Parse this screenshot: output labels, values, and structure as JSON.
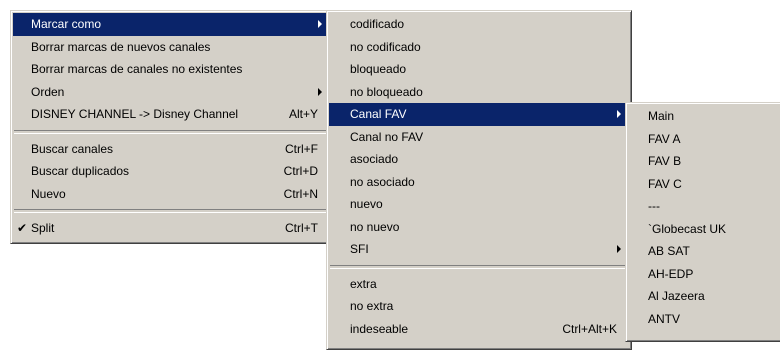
{
  "menu1": {
    "items": [
      {
        "label": "Marcar como"
      },
      {
        "label": "Borrar marcas de nuevos canales"
      },
      {
        "label": "Borrar marcas de canales no existentes"
      },
      {
        "label": "Orden"
      },
      {
        "label": "DISNEY CHANNEL -> Disney Channel",
        "shortcut": "Alt+Y"
      },
      {
        "label": "Buscar canales",
        "shortcut": "Ctrl+F"
      },
      {
        "label": "Buscar duplicados",
        "shortcut": "Ctrl+D"
      },
      {
        "label": "Nuevo",
        "shortcut": "Ctrl+N"
      },
      {
        "label": "Split",
        "shortcut": "Ctrl+T",
        "check": "✔"
      }
    ]
  },
  "menu2": {
    "items": [
      {
        "label": "codificado"
      },
      {
        "label": "no codificado"
      },
      {
        "label": "bloqueado"
      },
      {
        "label": "no bloqueado"
      },
      {
        "label": "Canal FAV"
      },
      {
        "label": "Canal no FAV"
      },
      {
        "label": "asociado"
      },
      {
        "label": "no asociado"
      },
      {
        "label": "nuevo"
      },
      {
        "label": "no nuevo"
      },
      {
        "label": "SFI"
      },
      {
        "label": "extra"
      },
      {
        "label": "no extra"
      },
      {
        "label": "indeseable",
        "shortcut": "Ctrl+Alt+K"
      }
    ]
  },
  "menu3": {
    "items": [
      {
        "label": "Main"
      },
      {
        "label": "FAV A"
      },
      {
        "label": "FAV B"
      },
      {
        "label": "FAV C"
      },
      {
        "label": "---"
      },
      {
        "label": "`Globecast UK"
      },
      {
        "label": "AB SAT"
      },
      {
        "label": "AH-EDP"
      },
      {
        "label": "Al Jazeera"
      },
      {
        "label": "ANTV"
      }
    ]
  },
  "colors": {
    "menu_bg": "#d4d0c8",
    "highlight": "#0a246a",
    "highlight_text": "#ffffff"
  }
}
